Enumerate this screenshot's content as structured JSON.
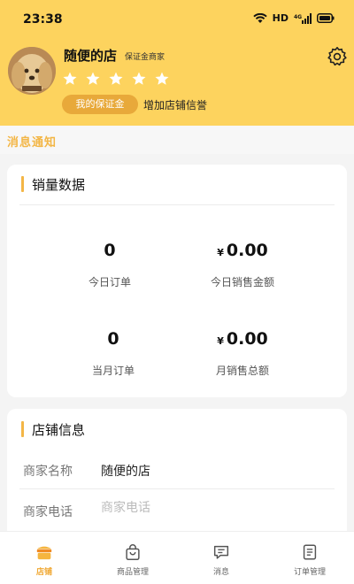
{
  "status_bar": {
    "time": "23:38",
    "network": "HD",
    "signal": "4G"
  },
  "profile": {
    "shop_name": "随便的店",
    "tag": "保证金商家",
    "star_count": 5,
    "deposit_button": "我的保证金",
    "credit_link": "增加店铺信誉"
  },
  "notice": {
    "label": "消息通知"
  },
  "sales": {
    "title": "销量数据",
    "currency": "¥",
    "today_orders": {
      "value": "0",
      "label": "今日订单"
    },
    "today_amount": {
      "value": "0.00",
      "label": "今日销售金额"
    },
    "month_orders": {
      "value": "0",
      "label": "当月订单"
    },
    "month_amount": {
      "value": "0.00",
      "label": "月销售总额"
    }
  },
  "shop_info": {
    "title": "店铺信息",
    "name_label": "商家名称",
    "name_value": "随便的店",
    "phone_label": "商家电话",
    "phone_placeholder": "商家电话"
  },
  "tabbar": {
    "items": [
      {
        "label": "店铺",
        "icon": "store-icon",
        "active": true
      },
      {
        "label": "商品管理",
        "icon": "bag-icon",
        "active": false
      },
      {
        "label": "消息",
        "icon": "message-icon",
        "active": false
      },
      {
        "label": "订单管理",
        "icon": "order-icon",
        "active": false
      }
    ]
  },
  "colors": {
    "header_bg": "#fdd35e",
    "accent": "#f3b646",
    "deposit_btn": "#e8a93a"
  }
}
